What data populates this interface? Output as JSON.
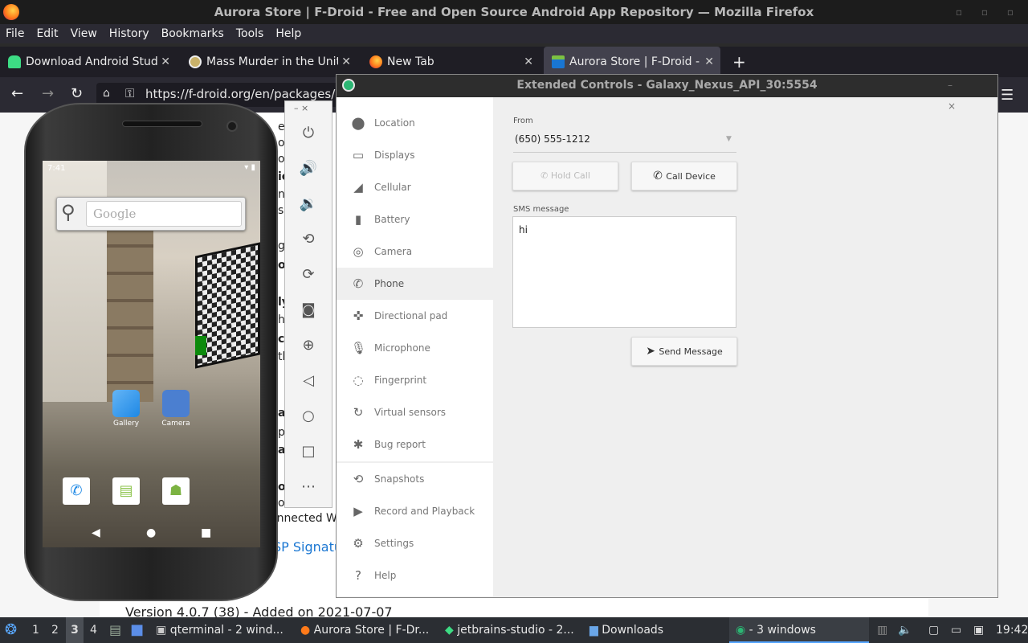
{
  "firefox": {
    "window_title": "Aurora Store | F-Droid - Free and Open Source Android App Repository — Mozilla Firefox",
    "menu": [
      "File",
      "Edit",
      "View",
      "History",
      "Bookmarks",
      "Tools",
      "Help"
    ],
    "tabs": [
      {
        "label": "Download Android Studio",
        "icon": "android-studio-icon"
      },
      {
        "label": "Mass Murder in the United",
        "icon": "site-favicon"
      },
      {
        "label": "New Tab",
        "icon": "firefox-icon"
      },
      {
        "label": "Aurora Store | F-Droid - Fr",
        "icon": "f-droid-icon"
      }
    ],
    "url": "https://f-droid.org/en/packages/co",
    "url_host": "f-droid.org"
  },
  "page": {
    "connected_text": "onnected W",
    "signature_text": "SP Signatu",
    "version_line": "Version 4.0.7 (38) - Added on 2021-07-07",
    "fragments": [
      "e",
      "o",
      "o",
      "ic",
      "n",
      "s.",
      "g",
      "o",
      "ly",
      "h",
      "c",
      "th",
      "ag",
      "p",
      "ag",
      "o",
      "o"
    ]
  },
  "phone": {
    "time": "7:41",
    "status_right": "▾ ▮",
    "search_placeholder": "Google",
    "apps": [
      {
        "label": "Gallery"
      },
      {
        "label": "Camera"
      }
    ]
  },
  "emulator_toolbar": {
    "controls": "–  ×",
    "items": [
      "power-icon",
      "volume-up-icon",
      "volume-down-icon",
      "rotate-left-icon",
      "rotate-right-icon",
      "camera-icon",
      "zoom-icon",
      "back-icon",
      "home-icon",
      "overview-icon",
      "more-icon"
    ]
  },
  "extended_controls": {
    "title": "Extended Controls - Galaxy_Nexus_API_30:5554",
    "sidebar": [
      {
        "label": "Location",
        "icon": "location-icon"
      },
      {
        "label": "Displays",
        "icon": "display-icon"
      },
      {
        "label": "Cellular",
        "icon": "cellular-icon"
      },
      {
        "label": "Battery",
        "icon": "battery-icon"
      },
      {
        "label": "Camera",
        "icon": "camera-icon"
      },
      {
        "label": "Phone",
        "icon": "phone-icon",
        "active": true
      },
      {
        "label": "Directional pad",
        "icon": "dpad-icon"
      },
      {
        "label": "Microphone",
        "icon": "microphone-icon"
      },
      {
        "label": "Fingerprint",
        "icon": "fingerprint-icon"
      },
      {
        "label": "Virtual sensors",
        "icon": "sensors-icon"
      },
      {
        "label": "Bug report",
        "icon": "bug-icon"
      },
      {
        "label": "Snapshots",
        "icon": "snapshots-icon"
      },
      {
        "label": "Record and Playback",
        "icon": "record-icon"
      },
      {
        "label": "Settings",
        "icon": "gear-icon"
      },
      {
        "label": "Help",
        "icon": "help-icon"
      }
    ],
    "phone": {
      "from_label": "From",
      "from_value": "(650) 555-1212",
      "hold_call": "Hold Call",
      "call_device": "Call Device",
      "sms_label": "SMS message",
      "sms_value": "hi",
      "send_message": "Send Message"
    }
  },
  "taskbar": {
    "workspaces": [
      "1",
      "2",
      "3",
      "4"
    ],
    "items": [
      {
        "label": "qterminal - 2 wind..."
      },
      {
        "label": "Aurora Store | F-Dr..."
      },
      {
        "label": "jetbrains-studio - 2..."
      },
      {
        "label": "Downloads"
      },
      {
        "label": "- 3 windows"
      }
    ],
    "clock": "19:42"
  },
  "colors": {
    "accent_blue": "#1976d2",
    "emulator_green": "#2bb673",
    "titlebar": "#2d2d2d"
  }
}
